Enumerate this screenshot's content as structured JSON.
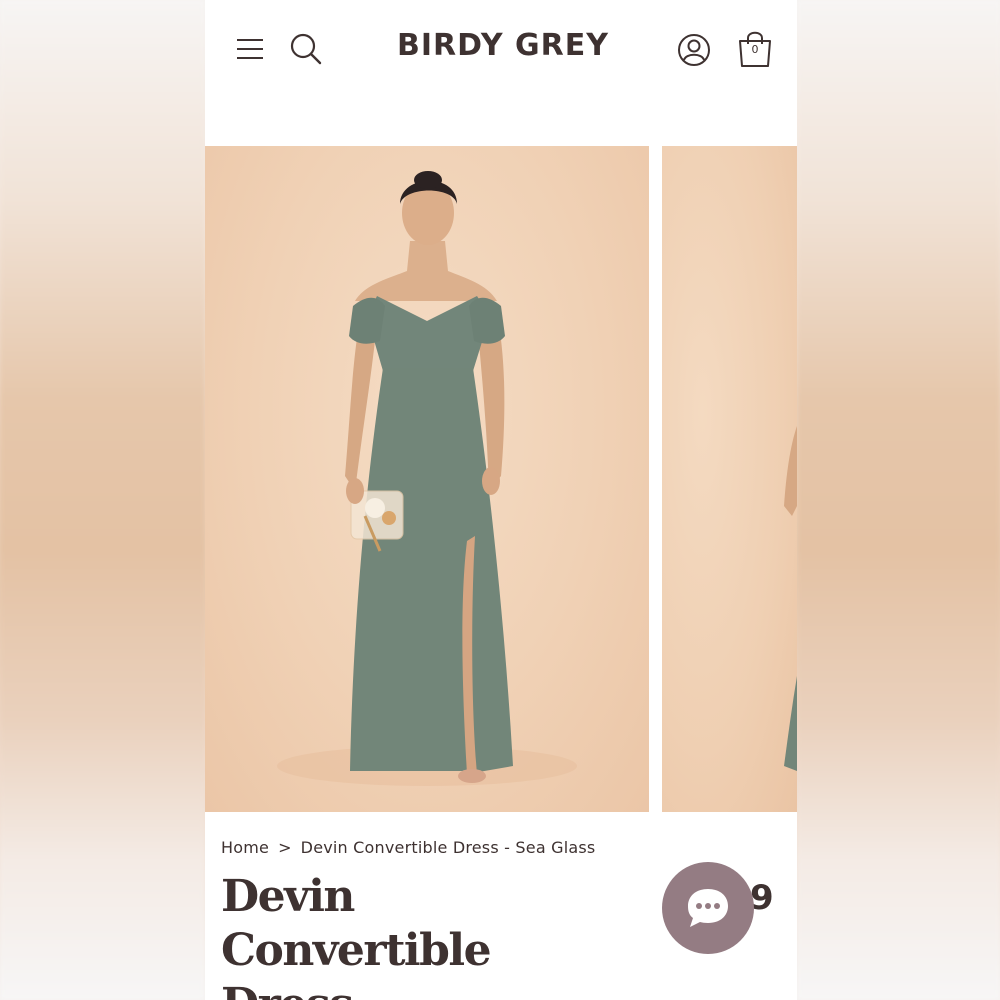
{
  "header": {
    "brand": "BIRDY GREY",
    "cart_count": "0",
    "icons": [
      "menu-icon",
      "search-icon",
      "account-icon",
      "shopping-bag-icon"
    ]
  },
  "gallery": {
    "dress_color": "#72867a",
    "backdrop_color": "#f0d1b5"
  },
  "product": {
    "breadcrumb": [
      "Home",
      "Devin Convertible Dress - Sea Glass"
    ],
    "breadcrumb_separator": ">",
    "title_line1": "Devin Convertible",
    "title_line2": "Dress",
    "price_peek": "9"
  },
  "chat": {
    "icon": "chat-bubble-icon",
    "color": "#947c83"
  }
}
